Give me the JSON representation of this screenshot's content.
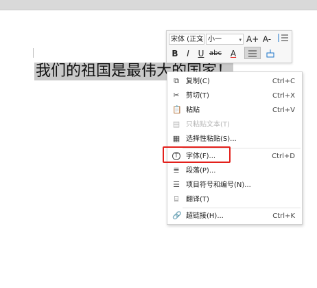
{
  "document": {
    "text": "我们的祖国是最伟大的国家！"
  },
  "mini_toolbar": {
    "font_name": "宋体 (正文",
    "font_size": "小一",
    "grow_font_label": "A+",
    "shrink_font_label": "A-",
    "bold": "B",
    "italic": "I",
    "underline": "U",
    "strikethrough": "abc",
    "font_color": "A"
  },
  "context_menu": {
    "items": [
      {
        "label": "复制(C)",
        "shortcut": "Ctrl+C",
        "icon": "copy-icon"
      },
      {
        "label": "剪切(T)",
        "shortcut": "Ctrl+X",
        "icon": "scissors-icon"
      },
      {
        "label": "粘贴",
        "shortcut": "Ctrl+V",
        "icon": "paste-icon"
      },
      {
        "label": "只粘贴文本(T)",
        "shortcut": "",
        "icon": "paste-text-icon",
        "disabled": true
      },
      {
        "label": "选择性粘贴(S)...",
        "shortcut": "",
        "icon": "paste-special-icon"
      },
      {
        "label": "字体(F)...",
        "shortcut": "Ctrl+D",
        "icon": "font-icon"
      },
      {
        "label": "段落(P)...",
        "shortcut": "",
        "icon": "paragraph-icon"
      },
      {
        "label": "项目符号和编号(N)...",
        "shortcut": "",
        "icon": "list-icon"
      },
      {
        "label": "翻译(T)",
        "shortcut": "",
        "icon": "translate-icon"
      },
      {
        "label": "超链接(H)...",
        "shortcut": "Ctrl+K",
        "icon": "link-icon"
      }
    ]
  },
  "colors": {
    "highlight_border": "#e3201b",
    "selection_bg": "#c9c9c9"
  }
}
